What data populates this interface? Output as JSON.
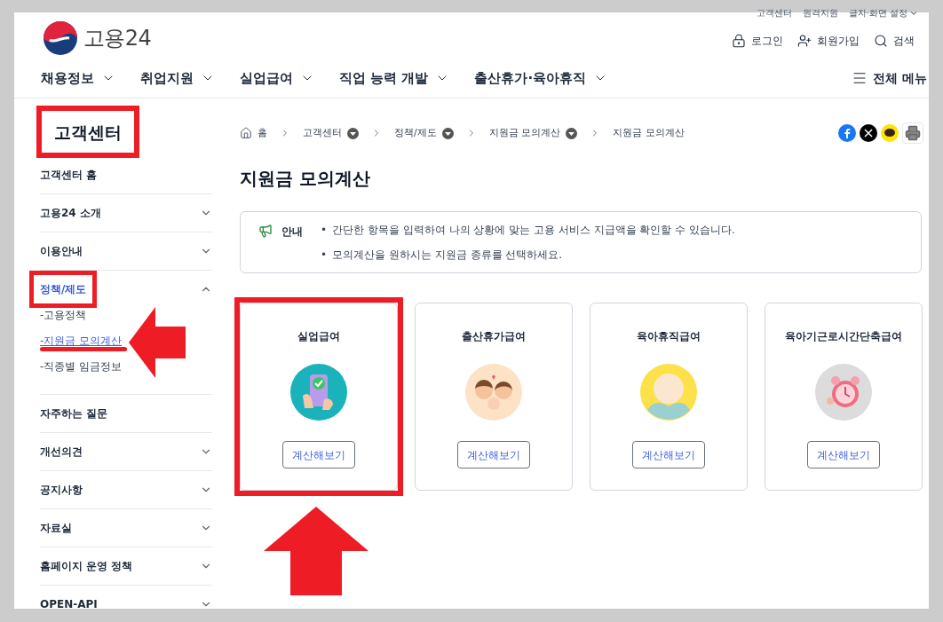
{
  "utility_links": [
    "고객센터",
    "원격지원",
    "글자·화면 설정"
  ],
  "logo": {
    "text": "고용24"
  },
  "header_actions": [
    {
      "kind": "login",
      "label": "로그인"
    },
    {
      "kind": "signup",
      "label": "회원가입"
    },
    {
      "kind": "search",
      "label": "검색"
    }
  ],
  "nav": [
    "채용정보",
    "취업지원",
    "실업급여",
    "직업 능력 개발",
    "출산휴가·육아휴직"
  ],
  "all_menu": "전체 메뉴",
  "sidebar": {
    "title": "고객센터",
    "highlighted": true,
    "items": [
      {
        "label": "고객센터 홈",
        "kind": "link",
        "selected": false,
        "highlighted": false
      },
      {
        "label": "고용24 소개",
        "kind": "menu",
        "expanded": false,
        "selected": false,
        "highlighted": false
      },
      {
        "label": "이용안내",
        "kind": "menu",
        "expanded": false,
        "selected": false,
        "highlighted": false
      },
      {
        "label": "정책/제도",
        "kind": "menu",
        "expanded": true,
        "selected": true,
        "highlighted": true,
        "children": [
          {
            "label": "-고용정책",
            "selected": false,
            "pointed": false
          },
          {
            "label": "-지원금 모의계산",
            "selected": true,
            "pointed": true
          },
          {
            "label": "-직종별 임금정보",
            "selected": false,
            "pointed": false
          }
        ]
      },
      {
        "label": "자주하는 질문",
        "kind": "link",
        "selected": false,
        "highlighted": false
      },
      {
        "label": "개선의견",
        "kind": "menu",
        "expanded": false,
        "selected": false,
        "highlighted": false
      },
      {
        "label": "공지사항",
        "kind": "menu",
        "expanded": false,
        "selected": false,
        "highlighted": false
      },
      {
        "label": "자료실",
        "kind": "menu",
        "expanded": false,
        "selected": false,
        "highlighted": false
      },
      {
        "label": "홈페이지 운영 정책",
        "kind": "menu",
        "expanded": false,
        "selected": false,
        "highlighted": false
      },
      {
        "label": "OPEN-API",
        "kind": "menu",
        "expanded": false,
        "selected": false,
        "highlighted": false
      }
    ]
  },
  "breadcrumb": [
    {
      "label": "홈",
      "kind": "home"
    },
    {
      "label": "고객센터",
      "kind": "menu"
    },
    {
      "label": "정책/제도",
      "kind": "menu"
    },
    {
      "label": "지원금 모의계산",
      "kind": "menu"
    },
    {
      "label": "지원금 모의계산",
      "kind": "current"
    }
  ],
  "share": [
    {
      "kind": "facebook"
    },
    {
      "kind": "x"
    },
    {
      "kind": "talk"
    },
    {
      "kind": "print"
    }
  ],
  "page_title": "지원금 모의계산",
  "notice": {
    "label": "안내",
    "bullet": "•",
    "lines": [
      "간단한 항목을 입력하여 나의 상황에 맞는 고용 서비스 지급액을 확인할 수 있습니다.",
      "모의계산을 원하시는 지원금 종류를 선택하세요."
    ]
  },
  "cards": [
    {
      "title": "실업급여",
      "kind": "phone",
      "button": "계산해보기",
      "highlighted": true,
      "pointed": true
    },
    {
      "title": "출산휴가급여",
      "kind": "family",
      "button": "계산해보기",
      "highlighted": false,
      "pointed": false
    },
    {
      "title": "육아휴직급여",
      "kind": "baby",
      "button": "계산해보기",
      "highlighted": false,
      "pointed": false
    },
    {
      "title": "육아기근로시간단축급여",
      "kind": "clock",
      "button": "계산해보기",
      "highlighted": false,
      "pointed": false
    }
  ]
}
